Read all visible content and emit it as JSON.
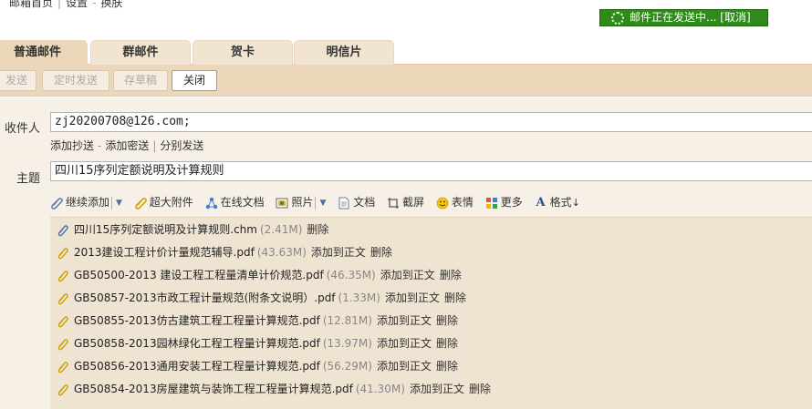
{
  "topnav": {
    "home": "邮箱首页",
    "settings": "设置",
    "skin": "换肤"
  },
  "send_status": {
    "text": "邮件正在发送中...",
    "cancel": "[取消]",
    "color": "#2e8b1a"
  },
  "tabs": [
    {
      "label": "普通邮件",
      "active": true
    },
    {
      "label": "群邮件",
      "active": false
    },
    {
      "label": "贺卡",
      "active": false
    },
    {
      "label": "明信片",
      "active": false
    }
  ],
  "toolbar": {
    "send": "发送",
    "scheduled": "定时发送",
    "draft": "存草稿",
    "close": "关闭"
  },
  "recipient": {
    "label": "收件人",
    "value": "zj20200708@126.com;"
  },
  "recipient_links": {
    "cc": "添加抄送",
    "bcc": "添加密送",
    "separate": "分别发送"
  },
  "subject": {
    "label": "主题",
    "value": "四川15序列定额说明及计算规则"
  },
  "attach_tools": {
    "continue_add": "继续添加",
    "large_attachment": "超大附件",
    "online_doc": "在线文档",
    "photo": "照片",
    "document": "文档",
    "screenshot": "截屏",
    "emoji": "表情",
    "more": "更多",
    "format": "格式"
  },
  "attachments": [
    {
      "name": "四川15序列定额说明及计算规则.chm",
      "size": "(2.41M)",
      "add_to_body": "",
      "delete": "删除"
    },
    {
      "name": "2013建设工程计价计量规范辅导.pdf",
      "size": "(43.63M)",
      "add_to_body": "添加到正文",
      "delete": "删除"
    },
    {
      "name": "GB50500-2013 建设工程工程量清单计价规范.pdf",
      "size": "(46.35M)",
      "add_to_body": "添加到正文",
      "delete": "删除"
    },
    {
      "name": "GB50857-2013市政工程计量规范(附条文说明）.pdf",
      "size": "(1.33M)",
      "add_to_body": "添加到正文",
      "delete": "删除"
    },
    {
      "name": "GB50855-2013仿古建筑工程工程量计算规范.pdf",
      "size": "(12.81M)",
      "add_to_body": "添加到正文",
      "delete": "删除"
    },
    {
      "name": "GB50858-2013园林绿化工程工程量计算规范.pdf",
      "size": "(13.97M)",
      "add_to_body": "添加到正文",
      "delete": "删除"
    },
    {
      "name": "GB50856-2013通用安装工程工程量计算规范.pdf",
      "size": "(56.29M)",
      "add_to_body": "添加到正文",
      "delete": "删除"
    },
    {
      "name": "GB50854-2013房屋建筑与装饰工程工程量计算规范.pdf",
      "size": "(41.30M)",
      "add_to_body": "添加到正文",
      "delete": "删除"
    }
  ],
  "colors": {
    "toolbar_bg": "#ecd7bb",
    "form_bg": "#f7f0e6",
    "attach_bg": "#efe3d2"
  }
}
